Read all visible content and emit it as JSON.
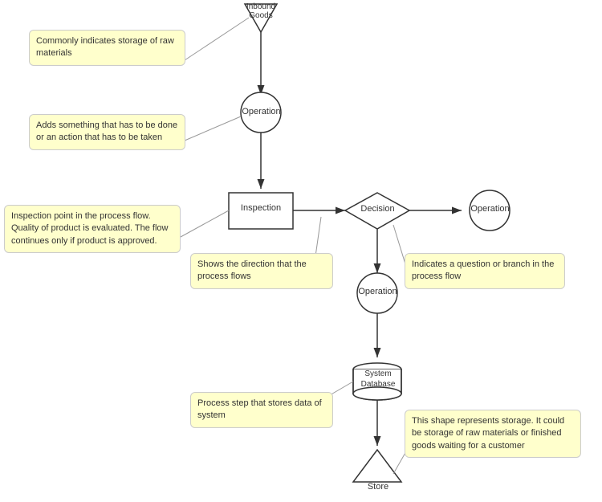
{
  "tooltips": {
    "storage": "Commonly indicates storage of raw materials",
    "operation_add": "Adds something that has to be done or an action that has to be taken",
    "inspection_point": "Inspection point in the process flow. Quality of product is evaluated. The flow continues only if product is approved.",
    "arrow_direction": "Shows the direction that the process flows",
    "decision_branch": "Indicates a question or branch in the process flow",
    "system_database": "Process step that stores data of system",
    "storage_shape": "This shape represents storage. It could be storage of raw materials or finished goods waiting for a customer"
  },
  "shapes": {
    "inbound_goods": "Inbound Goods",
    "operation1": "Operation",
    "inspection": "Inspection",
    "decision": "Decision",
    "operation2": "Operation",
    "operation3": "Operation",
    "system_database": "System\nDatabase",
    "store": "Store"
  },
  "colors": {
    "tooltip_bg": "#ffffcc",
    "tooltip_border": "#cccc99",
    "shape_fill": "#ffffff",
    "shape_stroke": "#333333",
    "arrow_color": "#333333"
  }
}
